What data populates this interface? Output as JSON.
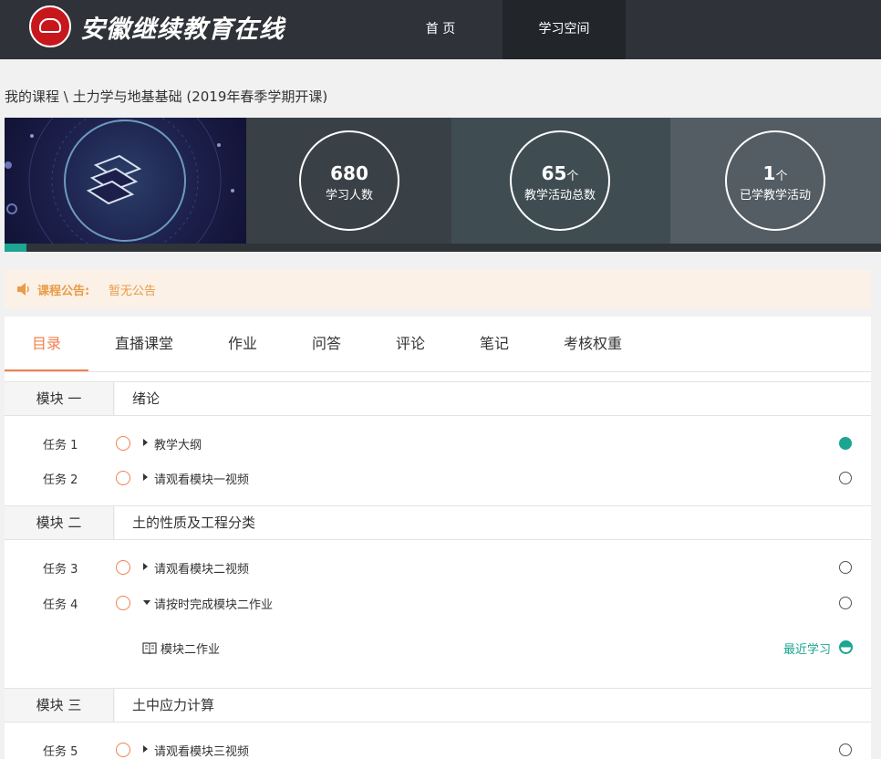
{
  "header": {
    "site_name": "安徽继续教育在线",
    "logo_icon": "school-emblem-icon",
    "nav": [
      {
        "label": "首 页",
        "active": false
      },
      {
        "label": "学习空间",
        "active": true
      }
    ]
  },
  "breadcrumb": "我的课程 \\ 土力学与地基基础 (2019年春季学期开课)",
  "stats": [
    {
      "value": "680",
      "unit": "",
      "label": "学习人数"
    },
    {
      "value": "65",
      "unit": "个",
      "label": "教学活动总数"
    },
    {
      "value": "1",
      "unit": "个",
      "label": "已学教学活动"
    }
  ],
  "progress_fraction": 0.025,
  "notice": {
    "icon": "speaker-icon",
    "label": "课程公告:",
    "text": "暂无公告"
  },
  "tabs": [
    "目录",
    "直播课堂",
    "作业",
    "问答",
    "评论",
    "笔记",
    "考核权重"
  ],
  "active_tab": 0,
  "modules": [
    {
      "label": "模块 一",
      "title": "绪论"
    },
    {
      "label": "模块 二",
      "title": "土的性质及工程分类"
    },
    {
      "label": "模块 三",
      "title": "土中应力计算"
    }
  ],
  "tasks": [
    {
      "label": "任务 1",
      "title": "教学大纲",
      "expanded": false,
      "status": "complete"
    },
    {
      "label": "任务 2",
      "title": "请观看模块一视频",
      "expanded": false,
      "status": "empty"
    },
    {
      "label": "任务 3",
      "title": "请观看模块二视频",
      "expanded": false,
      "status": "empty"
    },
    {
      "label": "任务 4",
      "title": "请按时完成模块二作业",
      "expanded": true,
      "status": "empty"
    },
    {
      "label": "任务 5",
      "title": "请观看模块三视频",
      "expanded": false,
      "status": "empty"
    }
  ],
  "subitem": {
    "icon": "book-icon",
    "title": "模块二作业",
    "recent_label": "最近学习",
    "status": "half"
  },
  "colors": {
    "accent": "#f0814f",
    "teal": "#1ba592",
    "header_bg": "#2f3238",
    "notice_text": "#e99b47"
  }
}
